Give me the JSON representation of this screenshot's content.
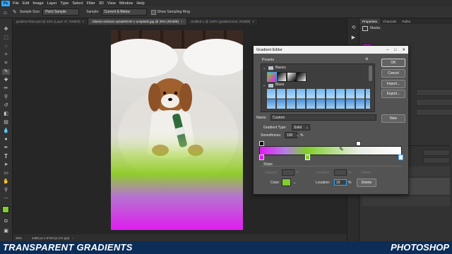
{
  "app": {
    "logo": "Ps"
  },
  "menu": [
    "File",
    "Edit",
    "Image",
    "Layer",
    "Type",
    "Select",
    "Filter",
    "3D",
    "View",
    "Window",
    "Help"
  ],
  "options_bar": {
    "sample_size_label": "Sample Size:",
    "sample_size_value": "Point Sample",
    "sample_label": "Sample:",
    "sample_value": "Current & Below",
    "show_ring_label": "Show Sampling Ring"
  },
  "tabs": [
    {
      "label": "gradient-flare.psd @ 40% (Layer 47, RGB/8)"
    },
    {
      "label": "roberto-nickson-xy5x8rNHG-c-unsplash.jpg @ 25% (RGB/8)"
    },
    {
      "label": "Untitled-1 @ 100% (gradient text, RGB/8)"
    }
  ],
  "status_bar": {
    "zoom": "25%",
    "doc_info": "4480 px x 6720 px (72 ppi)"
  },
  "panels": {
    "tabs": [
      "Properties",
      "Channels",
      "Paths"
    ],
    "masks_label": "Masks"
  },
  "gradient_editor": {
    "title": "Gradient Editor",
    "presets_label": "Presets",
    "basics_label": "Basics",
    "blues_label": "Blues",
    "ok": "OK",
    "cancel": "Cancel",
    "import": "Import...",
    "export": "Export...",
    "name_label": "Name:",
    "name_value": "Custom",
    "new": "New",
    "gradient_type_label": "Gradient Type:",
    "gradient_type_value": "Solid",
    "smoothness_label": "Smoothness:",
    "smoothness_value": "100",
    "percent": "%",
    "stops_label": "Stops",
    "opacity_label": "Opacity:",
    "location_label_1": "Location:",
    "delete_1": "Delete",
    "color_label": "Color:",
    "location_label_2": "Location:",
    "location_value": "33",
    "delete_2": "Delete"
  },
  "colors": {
    "magenta": "#e01cf0",
    "green": "#7fce2a",
    "accent": "#31a8ff"
  },
  "banner": {
    "left": "TRANSPARENT GRADIENTS",
    "right": "PHOTOSHOP"
  }
}
